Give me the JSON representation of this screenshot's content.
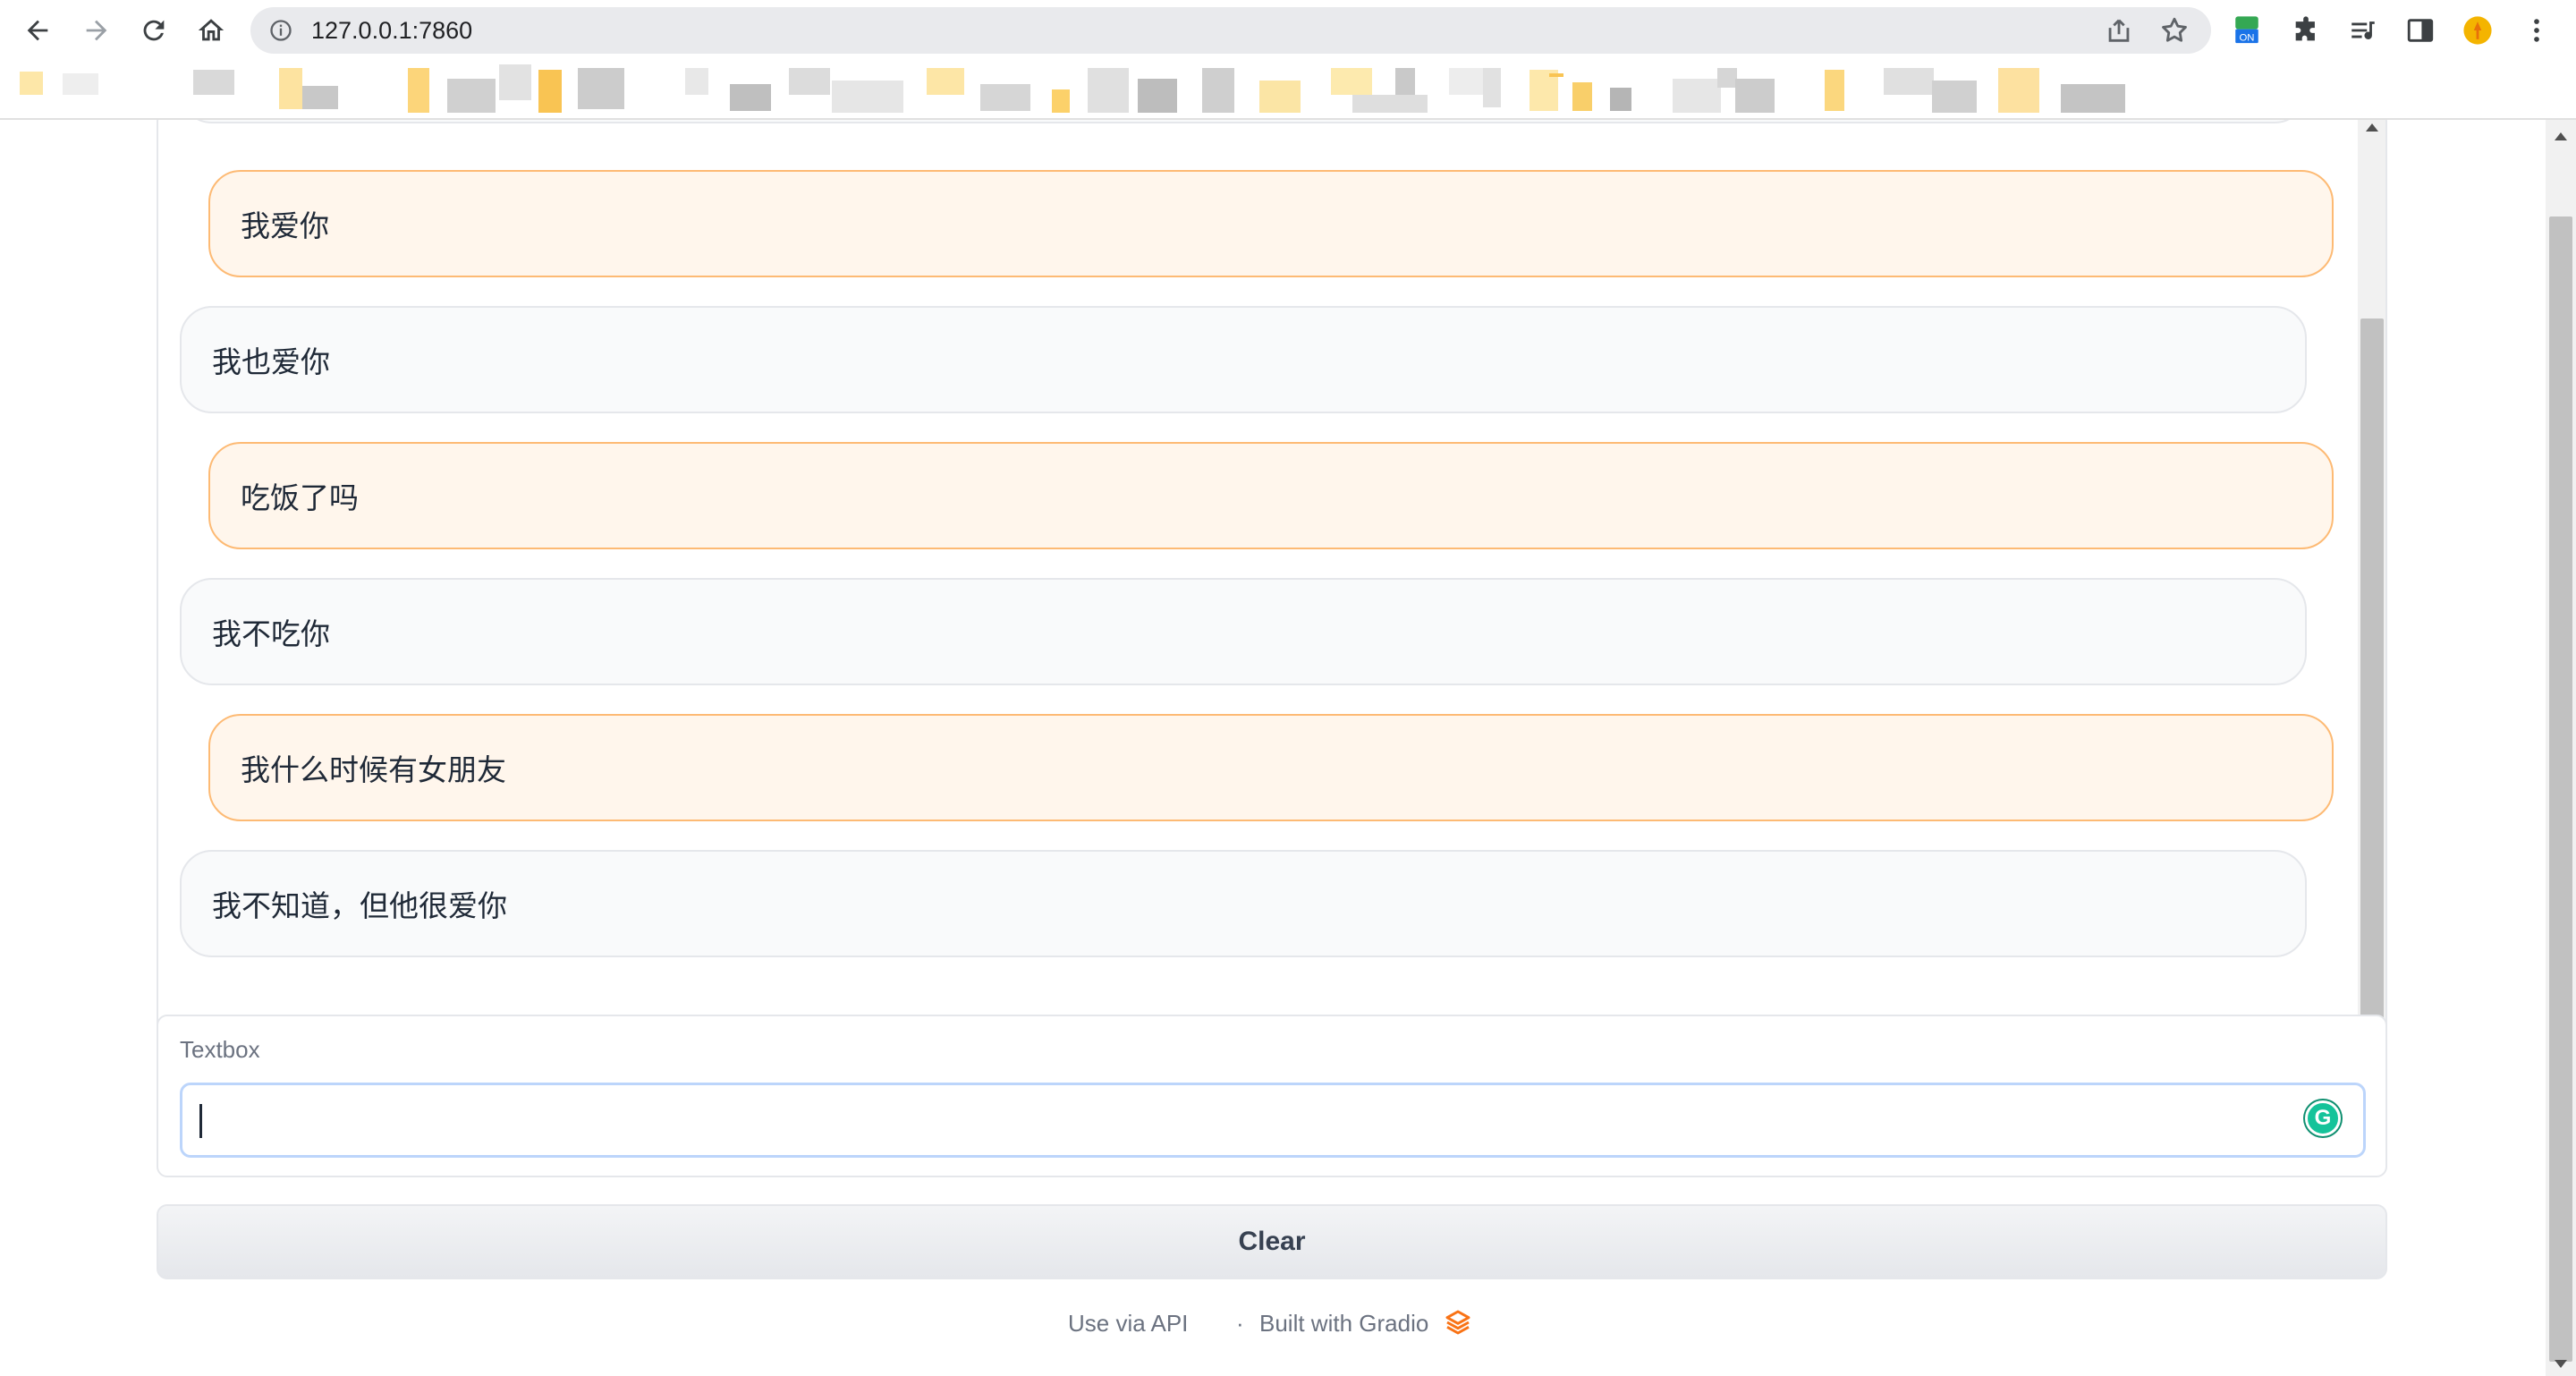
{
  "browser": {
    "url": "127.0.0.1:7860",
    "extension_badge": "ON"
  },
  "chat": {
    "messages": [
      {
        "role": "user",
        "text": "我爱你"
      },
      {
        "role": "bot",
        "text": "我也爱你"
      },
      {
        "role": "user",
        "text": "吃饭了吗"
      },
      {
        "role": "bot",
        "text": "我不吃你"
      },
      {
        "role": "user",
        "text": "我什么时候有女朋友"
      },
      {
        "role": "bot",
        "text": "我不知道，但他很爱你"
      }
    ],
    "user_color": "#fff6ec",
    "user_border": "#fdba74",
    "bot_color": "#f9fafb"
  },
  "textbox": {
    "label": "Textbox",
    "value": "",
    "placeholder": ""
  },
  "clear_label": "Clear",
  "footer": {
    "api_link": "Use via API",
    "separator": "·",
    "built_with": "Built with Gradio"
  }
}
